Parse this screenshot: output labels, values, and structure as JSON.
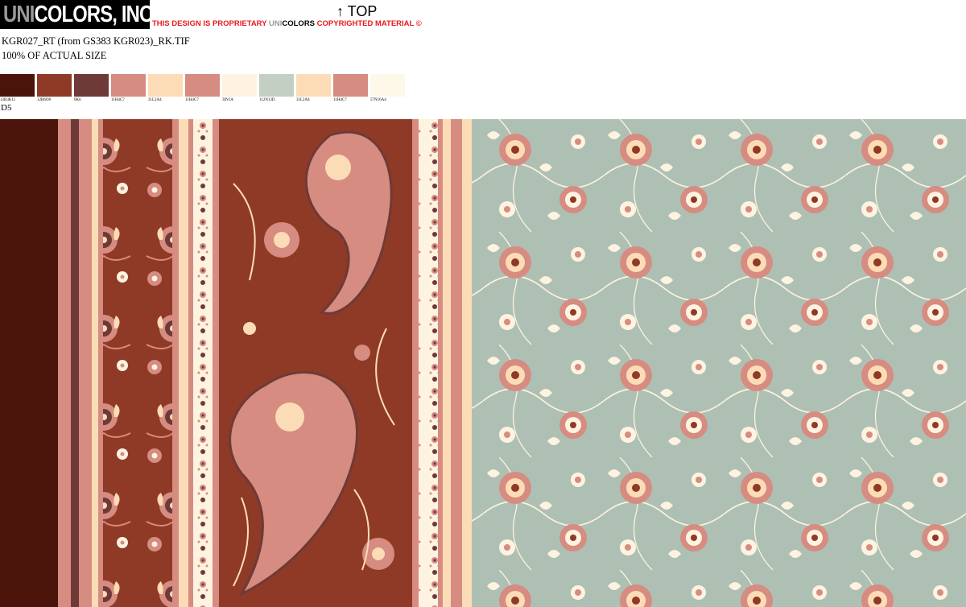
{
  "header": {
    "logo_uni": "UNI",
    "logo_rest": "COLORS, INC.",
    "notice_part1": "THIS DESIGN IS PROPRIETARY ",
    "notice_uni": "UNI",
    "notice_colors": "COLORS",
    "notice_part2": " COPYRIGHTED MATERIAL ©",
    "top_marker": "↑ TOP"
  },
  "file": {
    "name": "KGR027_RT (from GS383 KGR023)_RK.TIF",
    "scale": "100% OF ACTUAL SIZE"
  },
  "swatches": [
    {
      "color": "#4a140a",
      "code": "12B3K11"
    },
    {
      "color": "#8f3a26",
      "code": "12B6O8"
    },
    {
      "color": "#6e3a38",
      "code": "0K6"
    },
    {
      "color": "#d68c80",
      "code": "11H4C7"
    },
    {
      "color": "#fcdcb6",
      "code": "31L2A4"
    },
    {
      "color": "#d68c80",
      "code": "11H4C7"
    },
    {
      "color": "#fdf3e0",
      "code": "3IN1A"
    },
    {
      "color": "#c3cfc3",
      "code": "112N13D"
    },
    {
      "color": "#fcdcb6",
      "code": "31L2A4"
    },
    {
      "color": "#d68c80",
      "code": "11H4C7"
    },
    {
      "color": "#fdf8e8",
      "code": "57N16A4"
    }
  ],
  "design_label": "D5",
  "palette": {
    "dark_brown": "#4a140a",
    "rust": "#8f3a26",
    "plum": "#6e3a38",
    "rose": "#d68c80",
    "peach": "#fcdcb6",
    "cream": "#fdf3e0",
    "sage": "#aec0b4"
  }
}
